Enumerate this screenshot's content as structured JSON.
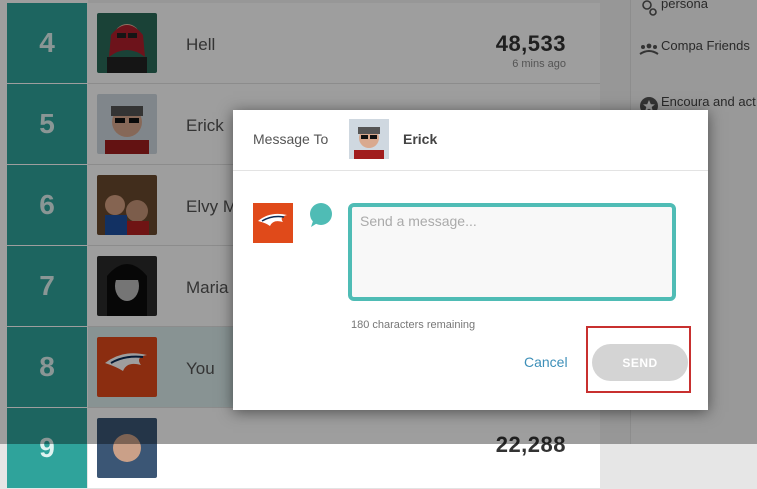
{
  "leaderboard": {
    "rows": [
      {
        "rank": "4",
        "name": "Hell",
        "score": "48,533",
        "time": "6 mins ago"
      },
      {
        "rank": "5",
        "name": "Erick",
        "score": "",
        "time": ""
      },
      {
        "rank": "6",
        "name": "Elvy M",
        "score": "",
        "time": ""
      },
      {
        "rank": "7",
        "name": "Maria",
        "score": "",
        "time": ""
      },
      {
        "rank": "8",
        "name": "You",
        "score": "",
        "time": ""
      },
      {
        "rank": "9",
        "name": "",
        "score": "22,288",
        "time": ""
      }
    ]
  },
  "sidebar": {
    "tips": [
      {
        "icon": "person-search-icon",
        "text": "persona"
      },
      {
        "icon": "friends-group-icon",
        "text": "Compa Friends"
      },
      {
        "icon": "star-badge-icon",
        "text": "Encoura and act"
      }
    ]
  },
  "modal": {
    "message_to_label": "Message To",
    "recipient_name": "Erick",
    "message_placeholder": "Send a message...",
    "chars_remaining": "180 characters remaining",
    "cancel_label": "Cancel",
    "send_label": "SEND"
  },
  "colors": {
    "rank_bg": "#2fa39b",
    "input_border": "#4fbcb5",
    "highlight_outline": "#c8302f",
    "link": "#3d8fb8"
  }
}
